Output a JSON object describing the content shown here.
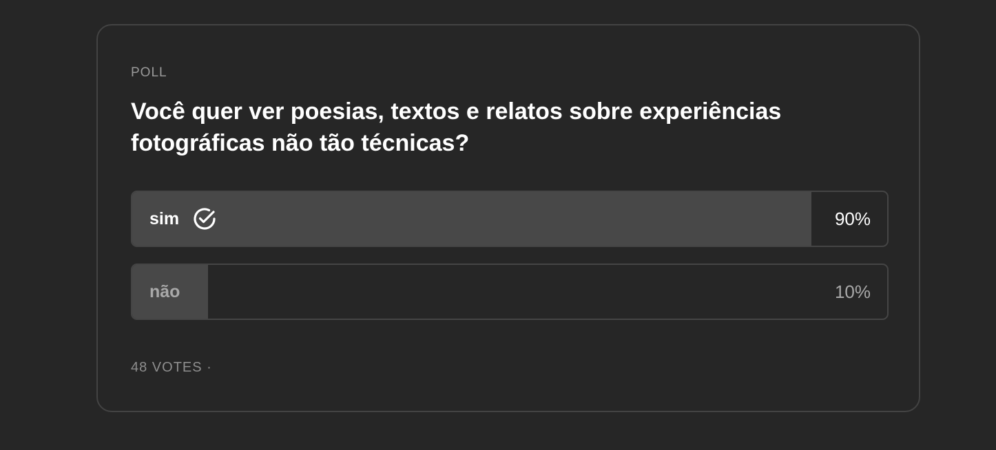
{
  "poll": {
    "kicker": "POLL",
    "question": "Você quer ver poesias, textos e relatos sobre experiências fotográficas não tão técnicas?",
    "options": [
      {
        "label": "sim",
        "percent_label": "90%",
        "percent": 90,
        "selected": true,
        "icon": "check-circle-icon"
      },
      {
        "label": "não",
        "percent_label": "10%",
        "percent": 10,
        "selected": false
      }
    ],
    "footer": "48 VOTES ·"
  },
  "colors": {
    "background": "#262626",
    "border": "#434343",
    "fill": "#484848",
    "text_primary": "#ffffff",
    "text_muted": "#a9a9a9"
  }
}
